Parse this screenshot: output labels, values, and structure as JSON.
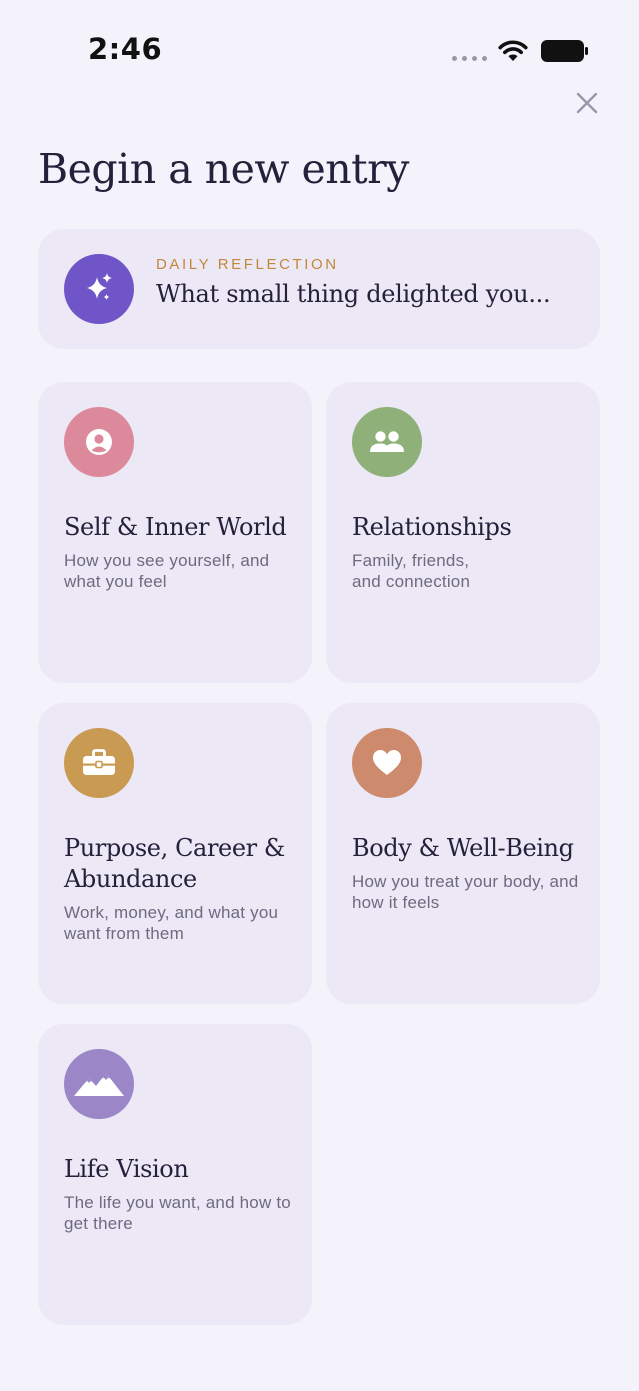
{
  "status_bar": {
    "time": "2:46"
  },
  "header": {
    "title": "Begin a new entry",
    "close_icon": "close-icon"
  },
  "daily_reflection": {
    "eyebrow": "DAILY REFLECTION",
    "prompt": "What small thing delighted you...",
    "icon": "sparkles-icon",
    "color": "#6f55c8"
  },
  "categories": [
    {
      "title": "Self & Inner World",
      "description": "How you see yourself, and what you feel",
      "icon": "person-icon",
      "color": "#dc8a9b"
    },
    {
      "title": "Relationships",
      "description": "Family, friends, and connection",
      "icon": "people-icon",
      "color": "#8fb079"
    },
    {
      "title": "Purpose, Career & Abundance",
      "description": "Work, money, and what you want from them",
      "icon": "briefcase-icon",
      "color": "#c99a52"
    },
    {
      "title": "Body & Well-Being",
      "description": "How you treat your body, and how it feels",
      "icon": "heart-icon",
      "color": "#cd8a6c"
    },
    {
      "title": "Life Vision",
      "description": "The life you want, and how to get there",
      "icon": "mountains-icon",
      "color": "#9b86c8"
    }
  ]
}
